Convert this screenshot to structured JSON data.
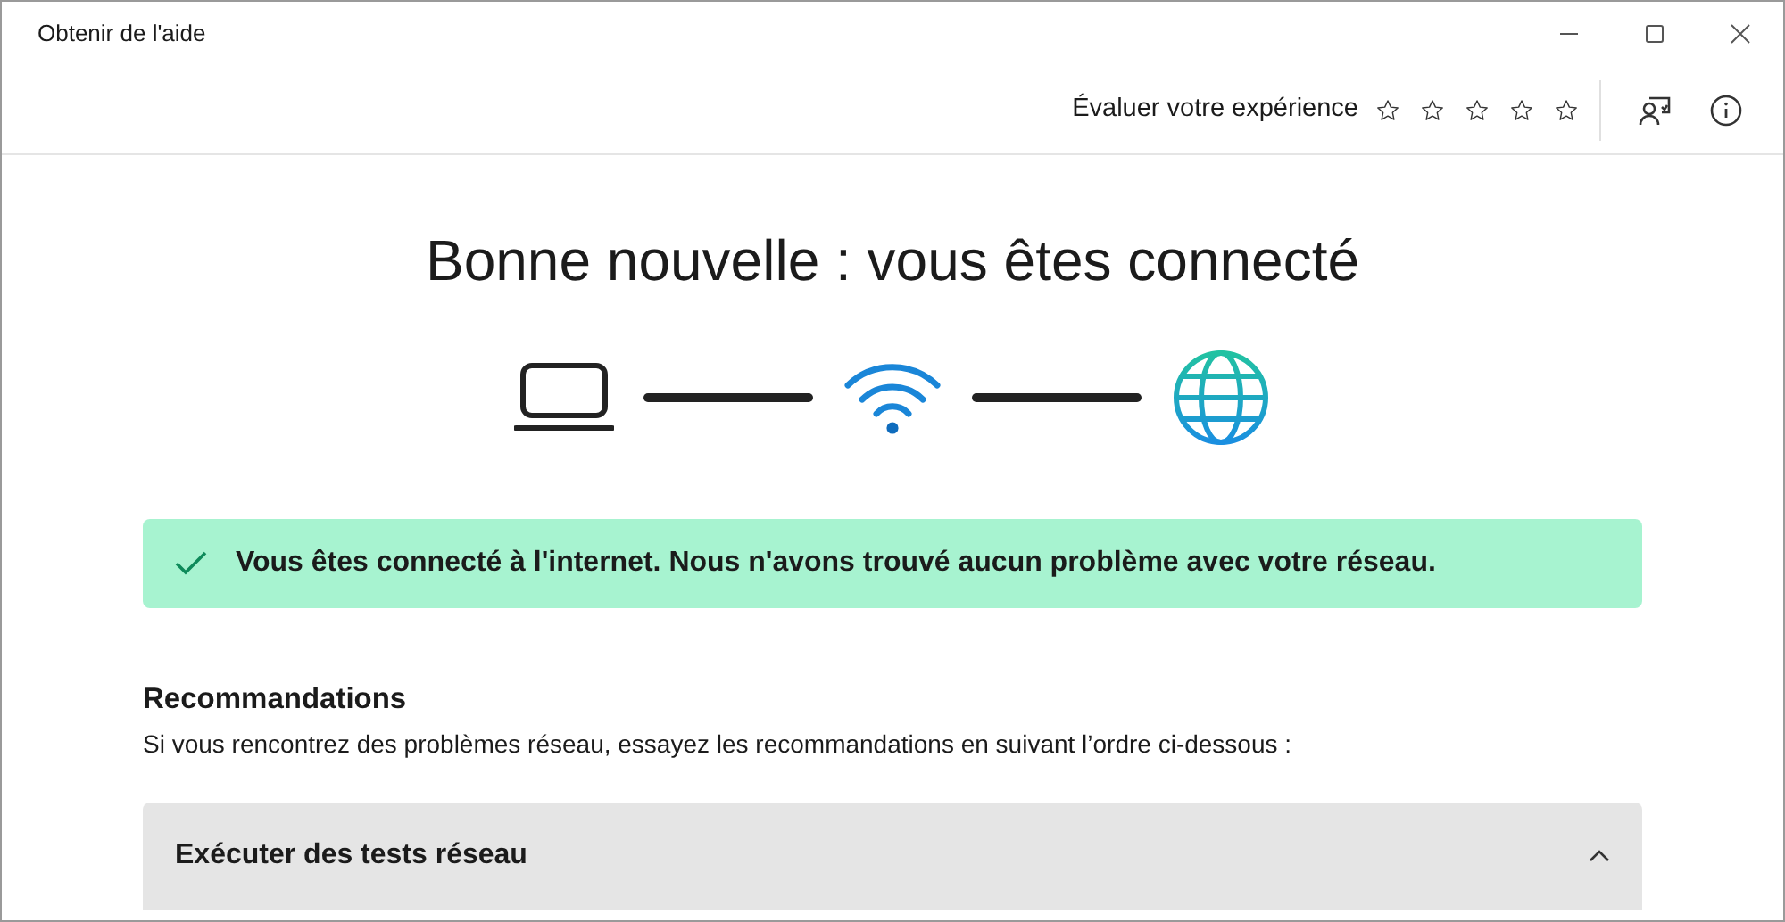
{
  "window": {
    "title": "Obtenir de l'aide"
  },
  "rating": {
    "label": "Évaluer votre expérience",
    "stars": 0
  },
  "heading": "Bonne nouvelle : vous êtes connecté",
  "banner": {
    "kind": "success",
    "text": "Vous êtes connecté à l'internet. Nous n'avons trouvé aucun problème avec votre réseau."
  },
  "recommendations": {
    "title": "Recommandations",
    "subtitle": "Si vous rencontrez des problèmes réseau, essayez les recommandations en suivant l’ordre ci-dessous :"
  },
  "sections": [
    {
      "title": "Exécuter des tests réseau",
      "expanded": true
    }
  ]
}
